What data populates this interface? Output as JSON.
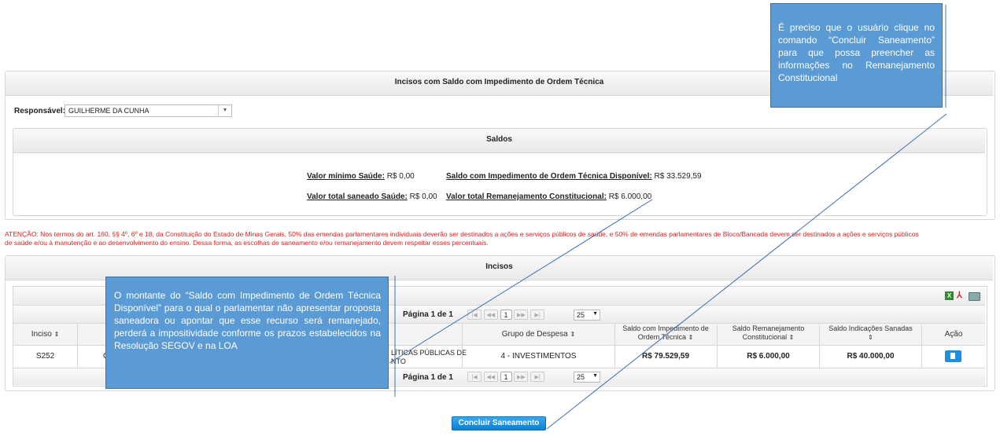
{
  "main_panel": {
    "title": "Incisos com Saldo com Impedimento de Ordem Técnica"
  },
  "responsavel": {
    "label": "Responsável:",
    "value": "GUILHERME DA CUNHA"
  },
  "saldos": {
    "title": "Saldos",
    "valor_minimo_saude_label": "Valor mínimo Saúde:",
    "valor_minimo_saude_value": "R$ 0,00",
    "saldo_impedimento_label": "Saldo com Impedimento de Ordem Técnica Disponível:",
    "saldo_impedimento_value": "R$ 33.529,59",
    "valor_total_saneado_label": "Valor total saneado Saúde:",
    "valor_total_saneado_value": "R$ 0,00",
    "valor_total_remanejamento_label": "Valor total Remanejamento Constitucional:",
    "valor_total_remanejamento_value": "R$ 6.000,00"
  },
  "warning": {
    "line1": "ATENÇÃO: Nos termos do art. 160, §§ 4º, 6º e 18, da Constituição do Estado de Minas Gerais, 50% das emendas parlamentares individuais deverão ser destinados a ações e serviços públicos de saúde, e 50% de emendas parlamentares de Bloco/Bancada devem ser destinados a ações e serviços públicos",
    "line2": "de saúde e/ou à manutenção e ao desenvolvimento do ensino. Dessa forma, as escolhas de saneamento e/ou remanejamento devem respeitar esses percentuais."
  },
  "incisos": {
    "title": "Incisos",
    "pagination": {
      "text": "Página 1 de 1",
      "page": "1",
      "per_page": "25",
      "first": "|◀",
      "prev": "◀◀",
      "next": "▶▶",
      "last": "▶|"
    },
    "columns": {
      "inciso": "Inciso",
      "grupo_despesa": "Grupo de Despesa",
      "saldo_impedimento": "Saldo com Impedimento de Ordem Técnica",
      "saldo_remanejamento": "Saldo Remanejamento Constitucional",
      "saldo_indicacoes": "Saldo Indicações Sanadas",
      "acao": "Ação"
    },
    "rows": [
      {
        "inciso": "S252",
        "col2_fragment": "C",
        "descricao_fragment1": "LÍTICAS PÚBLICAS DE",
        "descricao_fragment2": "NTO",
        "grupo_despesa": "4 - INVESTIMENTOS",
        "saldo_impedimento": "R$ 79.529,59",
        "saldo_remanejamento": "R$ 6.000,00",
        "saldo_indicacoes": "R$ 40.000,00"
      }
    ]
  },
  "concluir_button": "Concluir Saneamento",
  "callouts": {
    "top_right": "É preciso que o usuário clique no comando “Concluir Saneamento” para que possa preencher as informações no Remanejamento Constitucional",
    "left": "O montante do “Saldo com Impedimento de Ordem Técnica Disponível” para o qual o parlamentar não apresentar proposta saneadora ou apontar que esse recurso será remanejado, perderá a impositividade conforme os prazos estabelecidos na Resolução SEGOV e na LOA"
  },
  "colors": {
    "callout_bg": "#5b9bd5",
    "warning_text": "#e02020",
    "button_blue": "#1a8fe3"
  }
}
